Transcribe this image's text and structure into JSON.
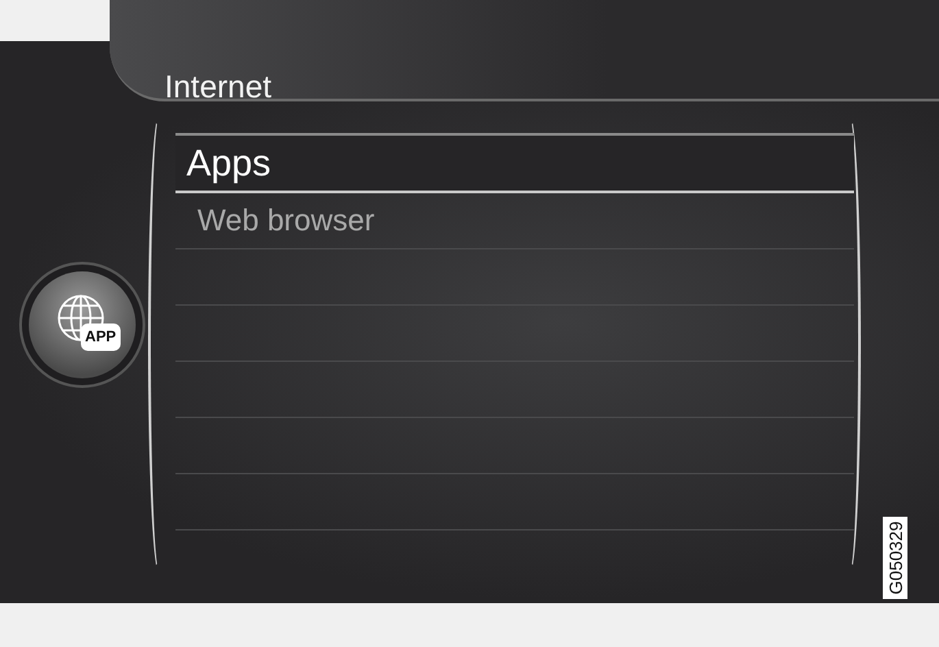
{
  "header": {
    "title": "Internet"
  },
  "app_button": {
    "label": "APP"
  },
  "menu": [
    {
      "label": "Apps",
      "selected": true
    },
    {
      "label": "Web browser",
      "selected": false
    }
  ],
  "figure_code": "G050329"
}
